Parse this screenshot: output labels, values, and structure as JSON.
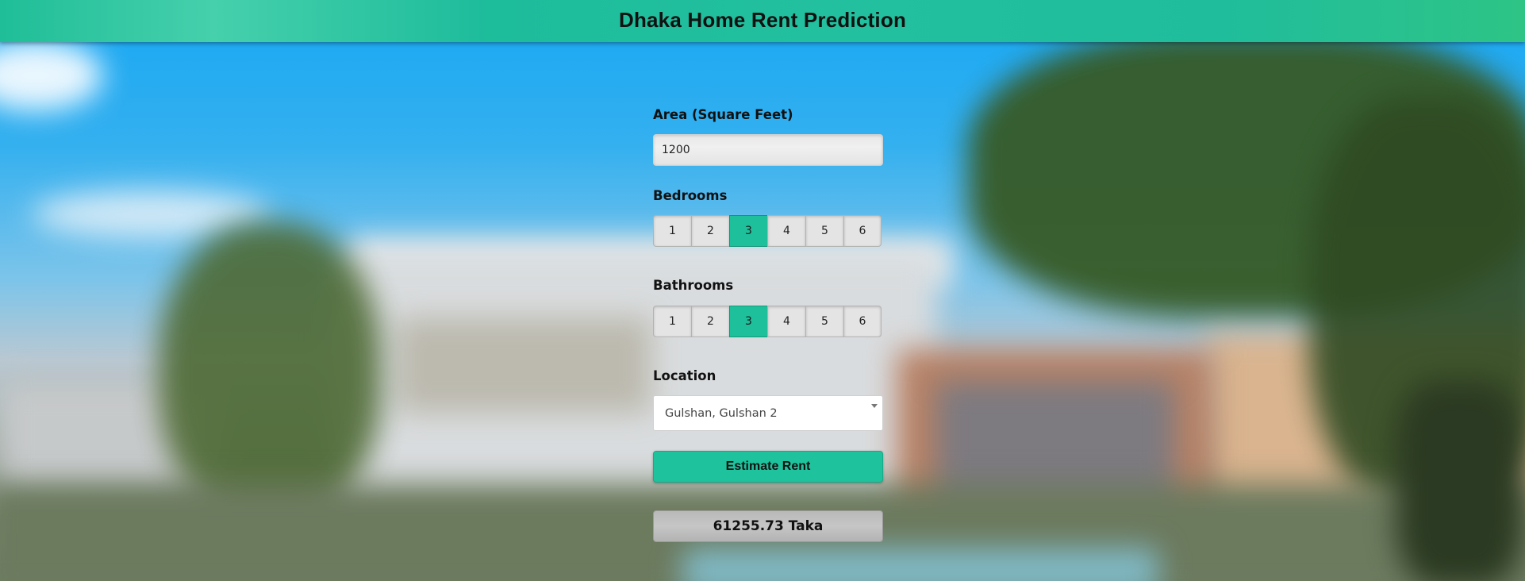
{
  "header": {
    "title": "Dhaka Home Rent Prediction"
  },
  "form": {
    "area": {
      "label": "Area (Square Feet)",
      "value": "1200"
    },
    "bedrooms": {
      "label": "Bedrooms",
      "options": [
        "1",
        "2",
        "3",
        "4",
        "5",
        "6"
      ],
      "selected": "3"
    },
    "bathrooms": {
      "label": "Bathrooms",
      "options": [
        "1",
        "2",
        "3",
        "4",
        "5",
        "6"
      ],
      "selected": "3"
    },
    "location": {
      "label": "Location",
      "selected": "Gulshan, Gulshan 2"
    },
    "estimate_button": "Estimate Rent",
    "result": "61255.73 Taka"
  },
  "colors": {
    "accent": "#1dc09b",
    "header": "#20bd9c",
    "result_bg": "#bdbdbd"
  },
  "icons": {
    "select_arrow": "chevron-down-icon"
  }
}
